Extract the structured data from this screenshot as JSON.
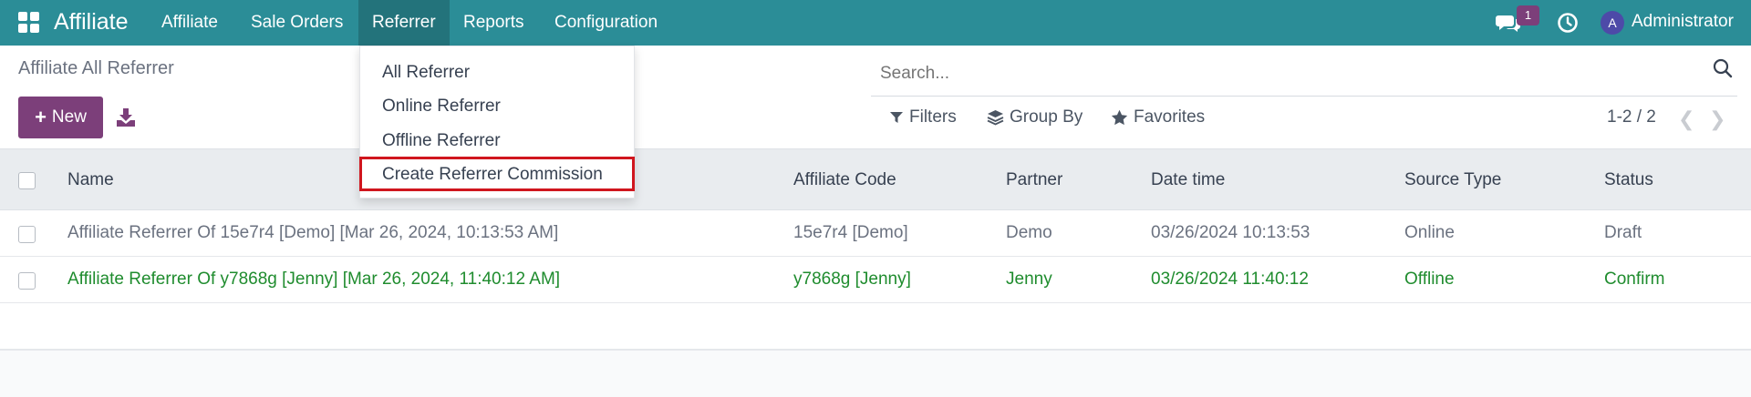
{
  "navbar": {
    "brand": "Affiliate",
    "menu": [
      {
        "label": "Affiliate"
      },
      {
        "label": "Sale Orders"
      },
      {
        "label": "Referrer"
      },
      {
        "label": "Reports"
      },
      {
        "label": "Configuration"
      }
    ],
    "messages_badge": "1",
    "user_initial": "A",
    "user_name": "Administrator",
    "bar_color": "#2b8d97"
  },
  "control_panel": {
    "title": "Affiliate All Referrer",
    "new_label": "New",
    "search_placeholder": "Search...",
    "filters_label": "Filters",
    "group_by_label": "Group By",
    "favorites_label": "Favorites",
    "pager": "1-2 / 2"
  },
  "dropdown": {
    "items": [
      {
        "label": "All Referrer"
      },
      {
        "label": "Online Referrer"
      },
      {
        "label": "Offline Referrer"
      },
      {
        "label": "Create Referrer Commission",
        "highlighted": true
      }
    ]
  },
  "table": {
    "columns": [
      "Name",
      "Affiliate Code",
      "Partner",
      "Date time",
      "Source Type",
      "Status"
    ],
    "rows": [
      {
        "name": "Affiliate Referrer Of 15e7r4 [Demo] [Mar 26, 2024, 10:13:53 AM]",
        "code": "15e7r4 [Demo]",
        "partner": "Demo",
        "datetime": "03/26/2024 10:13:53",
        "source": "Online",
        "status": "Draft"
      },
      {
        "name": "Affiliate Referrer Of y7868g [Jenny] [Mar 26, 2024, 11:40:12 AM]",
        "code": "y7868g [Jenny]",
        "partner": "Jenny",
        "datetime": "03/26/2024 11:40:12",
        "source": "Offline",
        "status": "Confirm"
      }
    ]
  },
  "colors": {
    "primary": "#7c3f7a",
    "confirm_text": "#1f8c2e",
    "highlight_box": "#d0161e"
  }
}
